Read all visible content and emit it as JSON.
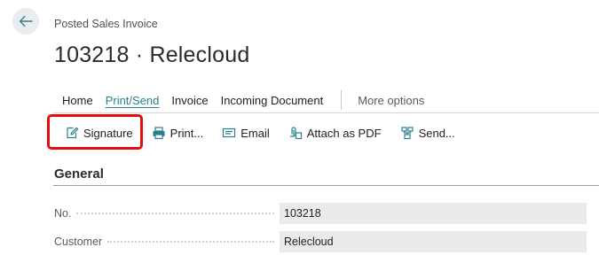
{
  "header": {
    "caption": "Posted Sales Invoice",
    "title": "103218 · Relecloud"
  },
  "tabs": [
    {
      "label": "Home"
    },
    {
      "label": "Print/Send"
    },
    {
      "label": "Invoice"
    },
    {
      "label": "Incoming Document"
    }
  ],
  "more_options": "More options",
  "actions": {
    "signature": "Signature",
    "print": "Print...",
    "email": "Email",
    "attach_pdf": "Attach as PDF",
    "send": "Send..."
  },
  "colors": {
    "accent": "#2a7f8c",
    "highlight": "#e30d0d"
  },
  "section": {
    "title": "General"
  },
  "fields": {
    "no": {
      "label": "No.",
      "value": "103218"
    },
    "customer": {
      "label": "Customer",
      "value": "Relecloud"
    }
  }
}
